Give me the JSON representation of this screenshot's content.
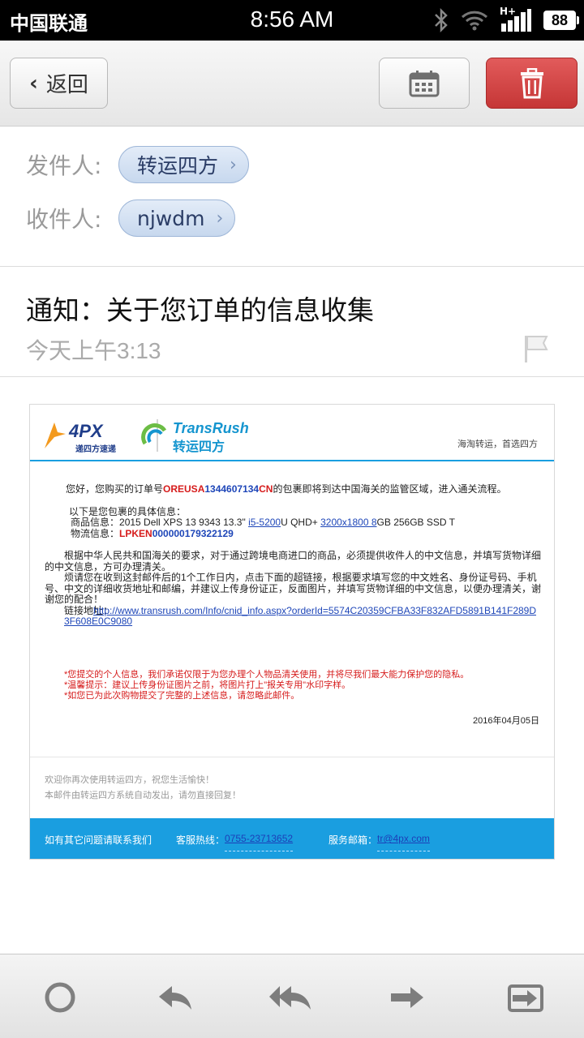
{
  "status": {
    "carrier": "中国联通",
    "time": "8:56 AM",
    "network": "H+",
    "battery": "88"
  },
  "toolbar": {
    "back_label": "返回",
    "calendar_icon": "calendar-icon",
    "delete_icon": "trash-icon",
    "delete_color": "#d04040"
  },
  "header": {
    "from_label": "发件人:",
    "from_value": "转运四方",
    "to_label": "收件人:",
    "to_value": "njwdm",
    "subject": "通知：关于您订单的信息收集",
    "date": "今天上午3:13"
  },
  "email": {
    "brand_4px": "4PX",
    "brand_4px_sub": "递四方速递",
    "brand_tr_en": "TransRush",
    "brand_tr_cn": "转运四方",
    "slogan": "海淘转运，首选四方",
    "greet_pre": "您好，您购买的订单号",
    "order_red": "OREUSA",
    "order_blue": "1344607134",
    "order_red2": "CN",
    "greet_post": "的包裹即将到达中国海关的监管区域，进入通关流程。",
    "info_title": "以下是您包裹的具体信息：",
    "goods_label": "商品信息：",
    "goods_a": "2015 Dell XPS 13 9343 13.3\" ",
    "goods_link1": "i5-5200",
    "goods_b": "U QHD+ ",
    "goods_link2": "3200x1800 8",
    "goods_c": "GB 256GB SSD T",
    "logistics_label": "物流信息：",
    "logistics_red": "LPKEN",
    "logistics_blue": "000000179322129",
    "para1": "根据中华人民共和国海关的要求，对于通过跨境电商进口的商品，必须提供收件人的中文信息，并填写货物详细的中文信息，方可办理清关。",
    "para2": "烦请您在收到这封邮件后的1个工作日内，点击下面的超链接，根据要求填写您的中文姓名、身份证号码、手机号、中文的详细收货地址和邮编，并建议上传身份证正，反面图片，并填写货物详细的中文信息，以便办理清关，谢谢您的配合！",
    "link_label": "链接地址：",
    "link_url": "http://www.transrush.com/Info/cnid_info.aspx?orderId=5574C20359CFBA33F832AFD5891B141F289D3F608E0C9080",
    "note1": "*您提交的个人信息，我们承诺仅限于为您办理个人物品清关使用，并将尽我们最大能力保护您的隐私。",
    "note2": "*温馨提示：建议上传身份证图片之前，将图片打上\"报关专用\"水印字样。",
    "note3": "*如您已为此次购物提交了完整的上述信息，请忽略此邮件。",
    "mail_date": "2016年04月05日",
    "footer1": "欢迎你再次使用转运四方，祝您生活愉快！",
    "footer2": "本邮件由转运四方系统自动发出，请勿直接回复！",
    "contact_label": "如有其它问题请联系我们",
    "hotline_label": "客服热线：",
    "hotline": "0755-23713652",
    "email_label": "服务邮箱：",
    "service_email": "tr@4px.com",
    "accent_color": "#1a9ee0"
  },
  "bottombar": {
    "icons": [
      "circle-icon",
      "reply-icon",
      "reply-all-icon",
      "forward-icon",
      "move-icon"
    ]
  }
}
